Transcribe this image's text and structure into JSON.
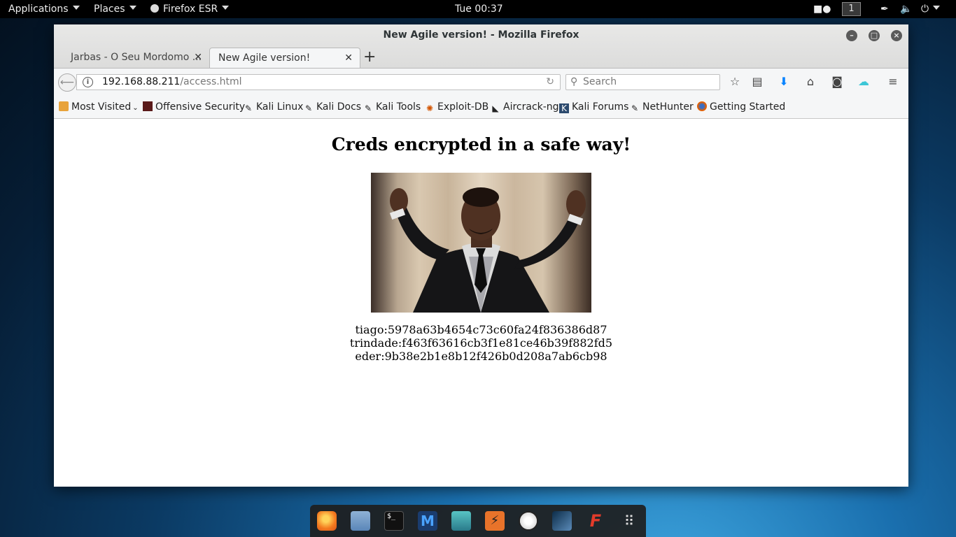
{
  "topbar": {
    "applications": "Applications",
    "places": "Places",
    "app_menu": "Firefox ESR",
    "clock": "Tue 00:37",
    "workspace": "1"
  },
  "window": {
    "title": "New Agile version! - Mozilla Firefox"
  },
  "tabs": [
    {
      "label": "Jarbas - O Seu Mordomo ..."
    },
    {
      "label": "New Agile version!"
    }
  ],
  "navbar": {
    "url_host": "192.168.88.211",
    "url_path": "/access.html",
    "search_placeholder": "Search"
  },
  "bookmarks": [
    {
      "label": "Most Visited"
    },
    {
      "label": "Offensive Security"
    },
    {
      "label": "Kali Linux"
    },
    {
      "label": "Kali Docs"
    },
    {
      "label": "Kali Tools"
    },
    {
      "label": "Exploit-DB"
    },
    {
      "label": "Aircrack-ng"
    },
    {
      "label": "Kali Forums"
    },
    {
      "label": "NetHunter"
    },
    {
      "label": "Getting Started"
    }
  ],
  "page": {
    "heading": "Creds encrypted in a safe way!",
    "creds": [
      "tiago:5978a63b4654c73c60fa24f836386d87",
      "trindade:f463f63616cb3f1e81ce46b39f882fd5",
      "eder:9b38e2b1e8b12f426b0d208a7ab6cb98"
    ]
  },
  "dock": [
    "firefox-icon",
    "files-icon",
    "terminal-icon",
    "metasploit-icon",
    "armitage-icon",
    "burpsuite-icon",
    "maltego-icon",
    "beef-icon",
    "faraday-icon",
    "app-grid-icon"
  ]
}
